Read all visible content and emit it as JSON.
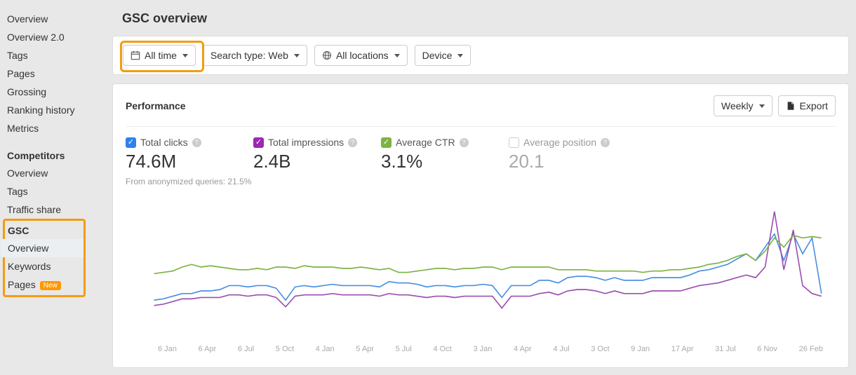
{
  "sidebar": {
    "items_top": [
      "Overview",
      "Overview 2.0",
      "Tags",
      "Pages",
      "Grossing",
      "Ranking history",
      "Metrics"
    ],
    "competitors_head": "Competitors",
    "items_competitors": [
      "Overview",
      "Tags",
      "Traffic share"
    ],
    "gsc_head": "GSC",
    "items_gsc": [
      "Overview",
      "Keywords",
      "Pages"
    ],
    "new_badge": "New"
  },
  "page_title": "GSC overview",
  "filters": {
    "time": "All time",
    "search_type": "Search type: Web",
    "locations": "All locations",
    "device": "Device"
  },
  "panel": {
    "title": "Performance",
    "weekly": "Weekly",
    "export": "Export"
  },
  "metrics": {
    "clicks_label": "Total clicks",
    "clicks_value": "74.6M",
    "impressions_label": "Total impressions",
    "impressions_value": "2.4B",
    "ctr_label": "Average CTR",
    "ctr_value": "3.1%",
    "position_label": "Average position",
    "position_value": "20.1",
    "subnote": "From anonymized queries: 21.5%"
  },
  "chart_data": {
    "type": "line",
    "x_ticks": [
      "6 Jan",
      "6 Apr",
      "6 Jul",
      "5 Oct",
      "4 Jan",
      "5 Apr",
      "5 Jul",
      "4 Oct",
      "3 Jan",
      "4 Apr",
      "4 Jul",
      "3 Oct",
      "9 Jan",
      "17 Apr",
      "31 Jul",
      "6 Nov",
      "26 Feb"
    ],
    "ylim": [
      0,
      100
    ],
    "series": [
      {
        "name": "Total clicks",
        "color": "#4a90e2",
        "values": [
          25,
          26,
          28,
          30,
          30,
          32,
          32,
          33,
          36,
          36,
          35,
          36,
          36,
          34,
          25,
          35,
          36,
          35,
          36,
          37,
          36,
          36,
          36,
          36,
          35,
          39,
          38,
          38,
          37,
          35,
          36,
          36,
          35,
          36,
          36,
          37,
          36,
          27,
          36,
          36,
          36,
          40,
          40,
          38,
          42,
          43,
          43,
          42,
          40,
          42,
          40,
          40,
          40,
          42,
          42,
          42,
          42,
          44,
          47,
          48,
          50,
          52,
          56,
          60,
          55,
          65,
          75,
          55,
          75,
          60,
          72,
          30
        ]
      },
      {
        "name": "Total impressions",
        "color": "#9b4fb0",
        "values": [
          21,
          22,
          24,
          26,
          26,
          27,
          27,
          27,
          29,
          29,
          28,
          29,
          29,
          27,
          20,
          28,
          29,
          29,
          29,
          30,
          29,
          29,
          29,
          29,
          28,
          30,
          29,
          29,
          28,
          27,
          28,
          28,
          27,
          28,
          28,
          28,
          28,
          19,
          28,
          28,
          28,
          30,
          31,
          29,
          32,
          33,
          33,
          32,
          30,
          32,
          30,
          30,
          30,
          32,
          32,
          32,
          32,
          34,
          36,
          37,
          38,
          40,
          42,
          44,
          42,
          50,
          92,
          48,
          78,
          36,
          30,
          28
        ]
      },
      {
        "name": "Average CTR",
        "color": "#7cb342",
        "values": [
          45,
          46,
          47,
          50,
          52,
          50,
          51,
          50,
          49,
          48,
          48,
          49,
          48,
          50,
          50,
          49,
          51,
          50,
          50,
          50,
          49,
          49,
          50,
          49,
          48,
          49,
          46,
          46,
          47,
          48,
          49,
          49,
          48,
          49,
          49,
          50,
          50,
          48,
          50,
          50,
          50,
          50,
          50,
          48,
          48,
          48,
          48,
          47,
          47,
          47,
          47,
          47,
          46,
          47,
          47,
          48,
          48,
          49,
          50,
          52,
          53,
          55,
          58,
          60,
          55,
          62,
          72,
          65,
          74,
          72,
          73,
          72
        ]
      }
    ]
  }
}
